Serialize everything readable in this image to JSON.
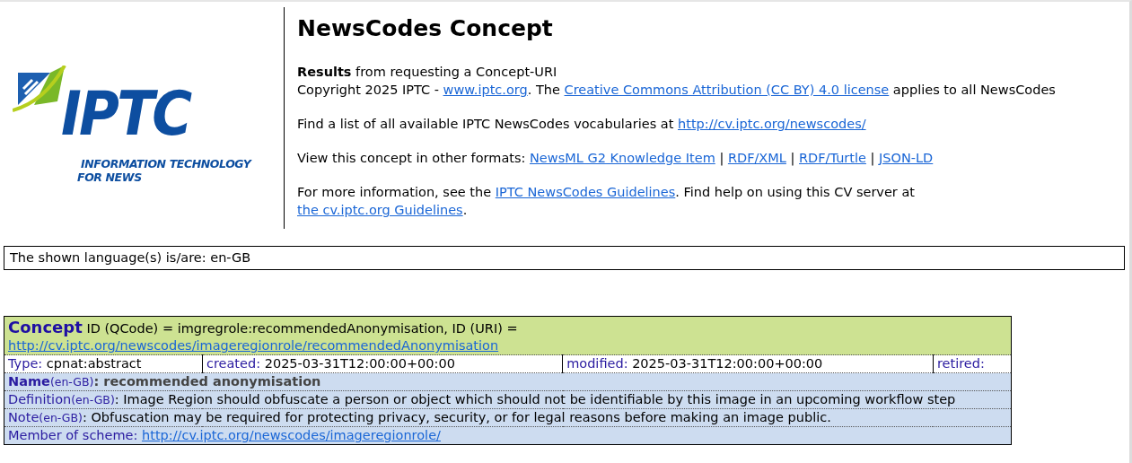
{
  "logo": {
    "wordmark": "IPTC",
    "tagline": [
      "INFORMATION TECHNOLOGY",
      "FOR NEWS"
    ]
  },
  "page_title": "NewsCodes Concept",
  "intro": [
    [
      [
        {
          "kind": "bold",
          "text": "Results"
        },
        {
          "kind": "text",
          "text": " from requesting a Concept-URI"
        }
      ],
      [
        {
          "kind": "text",
          "text": "Copyright 2025 IPTC - "
        },
        {
          "kind": "link",
          "text": "www.iptc.org"
        },
        {
          "kind": "text",
          "text": ". The "
        },
        {
          "kind": "link",
          "text": "Creative Commons Attribution (CC BY) 4.0 license"
        },
        {
          "kind": "text",
          "text": " applies to all NewsCodes"
        }
      ]
    ],
    [
      [
        {
          "kind": "text",
          "text": "Find a list of all available IPTC NewsCodes vocabularies at "
        },
        {
          "kind": "link",
          "text": "http://cv.iptc.org/newscodes/"
        }
      ]
    ],
    [
      [
        {
          "kind": "text",
          "text": "View this concept in other formats: "
        },
        {
          "kind": "link",
          "text": "NewsML G2 Knowledge Item"
        },
        {
          "kind": "text",
          "text": " | "
        },
        {
          "kind": "link",
          "text": "RDF/XML"
        },
        {
          "kind": "text",
          "text": " | "
        },
        {
          "kind": "link",
          "text": "RDF/Turtle"
        },
        {
          "kind": "text",
          "text": " | "
        },
        {
          "kind": "link",
          "text": "JSON-LD"
        }
      ]
    ],
    [
      [
        {
          "kind": "text",
          "text": "For more information, see the "
        },
        {
          "kind": "link",
          "text": "IPTC NewsCodes Guidelines"
        },
        {
          "kind": "text",
          "text": ". Find help on using this CV server at "
        },
        {
          "kind": "link",
          "text": "the cv.iptc.org Guidelines"
        },
        {
          "kind": "text",
          "text": "."
        }
      ]
    ]
  ],
  "language_note": "The shown language(s) is/are: en-GB",
  "concept": {
    "heading": "Concept",
    "id_text": "ID (QCode) = imgregrole:recommendedAnonymisation, ID (URI) =",
    "uri": "http://cv.iptc.org/newscodes/imageregionrole/recommendedAnonymisation",
    "attributes": [
      {
        "label": "Type:",
        "value": "cpnat:abstract"
      },
      {
        "label": "created:",
        "value": "2025-03-31T12:00:00+00:00"
      },
      {
        "label": "modified:",
        "value": "2025-03-31T12:00:00+00:00"
      },
      {
        "label": "retired:"
      }
    ],
    "rows": [
      {
        "kind": "name",
        "label": "Name",
        "lang": "(en-GB)",
        "value": ": recommended anonymisation"
      },
      {
        "kind": "text",
        "label": "Definition",
        "lang": "(en-GB)",
        "value": ": Image Region should obfuscate a person or object which should not be identifiable by this image in an upcoming workflow step"
      },
      {
        "kind": "text",
        "label": "Note",
        "lang": "(en-GB)",
        "value": ": Obfuscation may be required for protecting privacy, security, or for legal reasons before making an image public."
      },
      {
        "kind": "link",
        "label": "Member of scheme:",
        "value": "http://cv.iptc.org/newscodes/imageregionrole/"
      }
    ]
  }
}
